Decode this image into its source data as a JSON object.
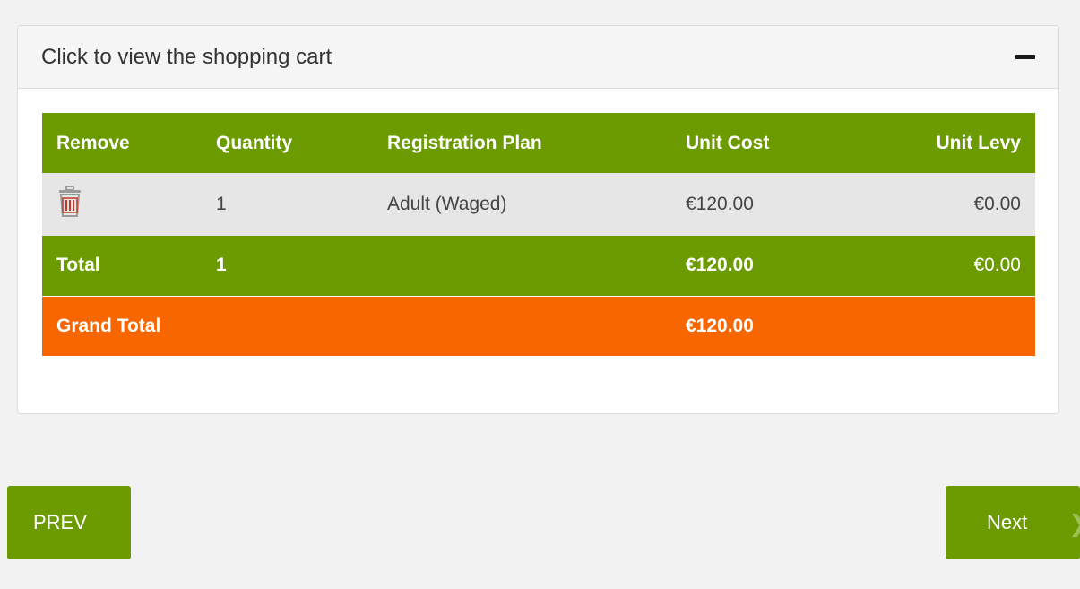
{
  "panel": {
    "title": "Click to view the shopping cart",
    "collapse_icon": "minus-icon"
  },
  "cart": {
    "headers": [
      "Remove",
      "Quantity",
      "Registration Plan",
      "Unit Cost",
      "Unit Levy"
    ],
    "items": [
      {
        "remove_icon": "trash-icon",
        "quantity": "1",
        "plan": "Adult (Waged)",
        "unit_cost": "€120.00",
        "unit_levy": "€0.00"
      }
    ],
    "total": {
      "label": "Total",
      "quantity": "1",
      "unit_cost": "€120.00",
      "unit_levy": "€0.00"
    },
    "grand_total": {
      "label": "Grand Total",
      "amount": "€120.00"
    }
  },
  "nav": {
    "prev_label": "PREV",
    "next_label": "Next",
    "next_icon": "chevron-right-icon"
  },
  "colors": {
    "green": "#6b9b00",
    "orange": "#f76600",
    "trash_red": "#c0392b"
  }
}
